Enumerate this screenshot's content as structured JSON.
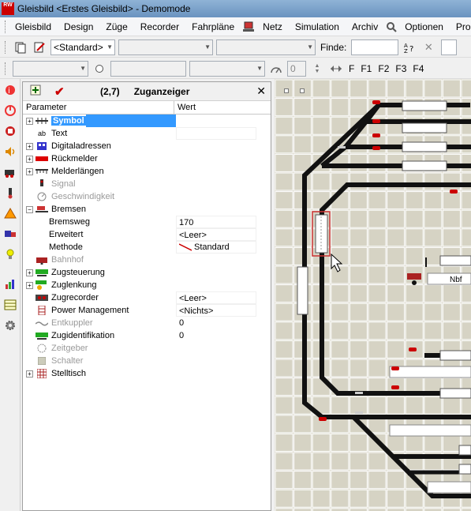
{
  "window": {
    "title": "Gleisbild <Erstes Gleisbild> - Demomode",
    "icon_text": "RW"
  },
  "menu": [
    {
      "id": "gleisbild",
      "label": "Gleisbild"
    },
    {
      "id": "design",
      "label": "Design"
    },
    {
      "id": "zuege",
      "label": "Züge"
    },
    {
      "id": "recorder",
      "label": "Recorder"
    },
    {
      "id": "fahrplaene",
      "label": "Fahrpläne"
    },
    {
      "id": "netz",
      "label": "Netz"
    },
    {
      "id": "simulation",
      "label": "Simulation"
    },
    {
      "id": "archiv",
      "label": "Archiv"
    },
    {
      "id": "optionen",
      "label": "Optionen"
    },
    {
      "id": "pro",
      "label": "Pro"
    }
  ],
  "toolbar1": {
    "style_combo": "<Standard>",
    "find_label": "Finde:"
  },
  "toolbar2": {
    "speed_value": "0",
    "f_buttons": [
      "F",
      "F1",
      "F2",
      "F3",
      "F4"
    ]
  },
  "panel": {
    "coord": "(2,7)",
    "title": "Zuganzeiger",
    "col_param": "Parameter",
    "col_value": "Wert",
    "rows": [
      {
        "label": "Symbol",
        "value": "",
        "expand": "+",
        "selected": true,
        "disabled": false
      },
      {
        "label": "Text",
        "value": "",
        "expand": "",
        "disabled": false,
        "icon_text": "ab"
      },
      {
        "label": "Digitaladressen",
        "value": "",
        "expand": "+",
        "disabled": false
      },
      {
        "label": "Rückmelder",
        "value": "",
        "expand": "+",
        "disabled": false
      },
      {
        "label": "Melderlängen",
        "value": "",
        "expand": "+",
        "disabled": false
      },
      {
        "label": "Signal",
        "value": "",
        "expand": "",
        "disabled": true
      },
      {
        "label": "Geschwindigkeit",
        "value": "",
        "expand": "",
        "disabled": true
      },
      {
        "label": "Bremsen",
        "value": "",
        "expand": "−",
        "disabled": false
      },
      {
        "label": "Bremsweg",
        "value": "170",
        "child": true
      },
      {
        "label": "Erweitert",
        "value": "<Leer>",
        "child": true
      },
      {
        "label": "Methode",
        "value": "Standard",
        "child": true
      },
      {
        "label": "Bahnhof",
        "value": "",
        "expand": "",
        "disabled": true
      },
      {
        "label": "Zugsteuerung",
        "value": "",
        "expand": "+",
        "disabled": false
      },
      {
        "label": "Zuglenkung",
        "value": "",
        "expand": "+",
        "disabled": false
      },
      {
        "label": "Zugrecorder",
        "value": "<Leer>",
        "expand": "",
        "disabled": false
      },
      {
        "label": "Power Management",
        "value": "<Nichts>",
        "expand": "",
        "disabled": false
      },
      {
        "label": "Entkuppler",
        "value": "0",
        "expand": "",
        "disabled": true
      },
      {
        "label": "Zugidentifikation",
        "value": "0",
        "expand": "",
        "disabled": false
      },
      {
        "label": "Zeitgeber",
        "value": "",
        "expand": "",
        "disabled": true
      },
      {
        "label": "Schalter",
        "value": "",
        "expand": "",
        "disabled": true
      },
      {
        "label": "Stelltisch",
        "value": "",
        "expand": "+",
        "disabled": false
      }
    ]
  },
  "map": {
    "station_label": "Nbf"
  },
  "colors": {
    "grid_bg": "#d6d3c4",
    "track": "#111111",
    "selection": "#3399ff"
  }
}
